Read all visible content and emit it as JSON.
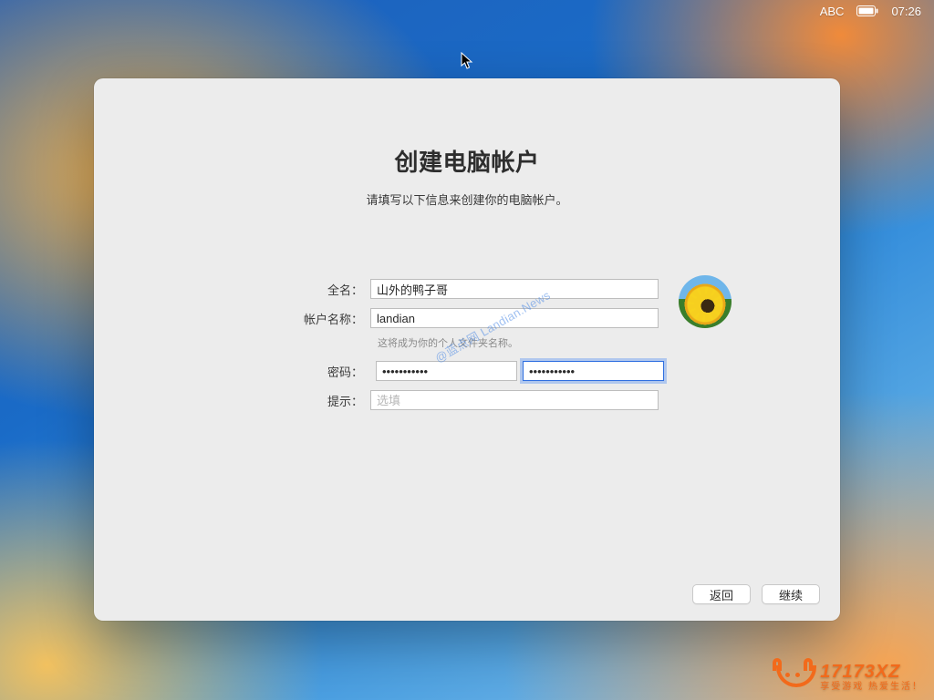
{
  "menubar": {
    "input_indicator": "ABC",
    "clock": "07:26"
  },
  "window": {
    "title": "创建电脑帐户",
    "subtitle": "请填写以下信息来创建你的电脑帐户。"
  },
  "form": {
    "full_name": {
      "label": "全名：",
      "value": "山外的鸭子哥"
    },
    "account": {
      "label": "帐户名称：",
      "value": "landian",
      "helper": "这将成为你的个人文件夹名称。"
    },
    "password": {
      "label": "密码：",
      "value": "•••••••••••",
      "confirm_value": "•••••••••••"
    },
    "hint": {
      "label": "提示：",
      "placeholder": "选填",
      "value": ""
    }
  },
  "buttons": {
    "back": "返回",
    "continue": "继续"
  },
  "watermark": "@蓝点网 Landian.News",
  "brand": {
    "name": "17173",
    "suffix": "XZ",
    "tagline": "享受游戏  热爱生活！"
  }
}
